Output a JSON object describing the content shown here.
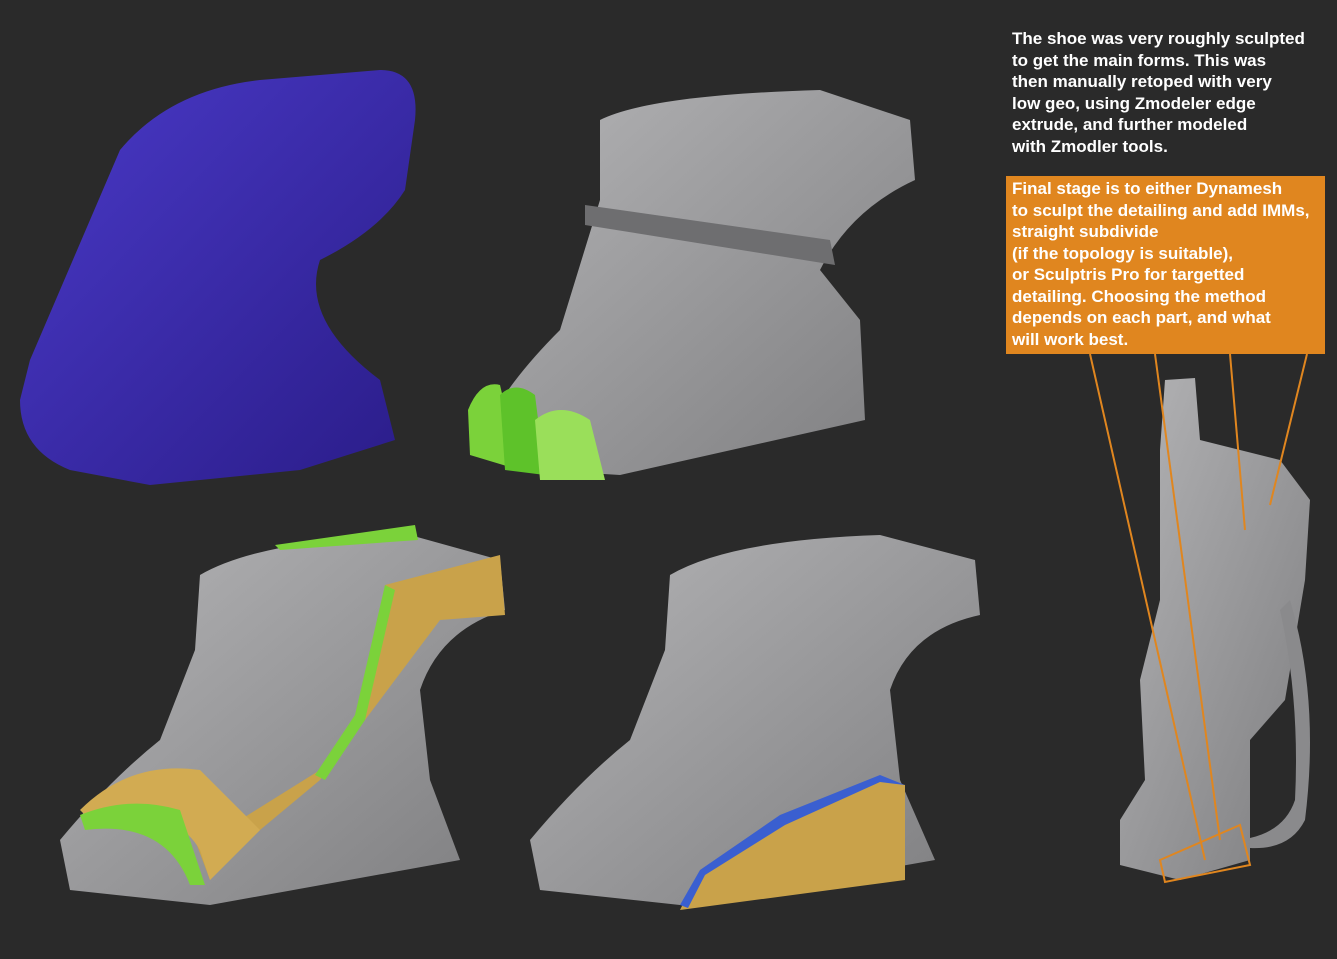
{
  "notes": {
    "intro": "The shoe was very roughly sculpted\nto get the main forms. This was\nthen manually retoped with very\nlow geo, using Zmodeler edge\nextrude, and further modeled\nwith Zmodler tools.",
    "final_stage": "Final stage is to either Dynamesh\nto sculpt the detailing and add IMMs,\nstraight subdivide\n(if the topology is suitable),\nor Sculptris Pro for targetted\ndetailing. Choosing the method\ndepends on each part, and what\nwill work best."
  },
  "colors": {
    "background": "#2a2a2a",
    "callout": "#e0861f",
    "sculpt": "#3a2aa8",
    "mesh": "#9a9a9c",
    "green": "#7bd23a",
    "yellow": "#c9a24a",
    "blue": "#3a5fd0"
  }
}
